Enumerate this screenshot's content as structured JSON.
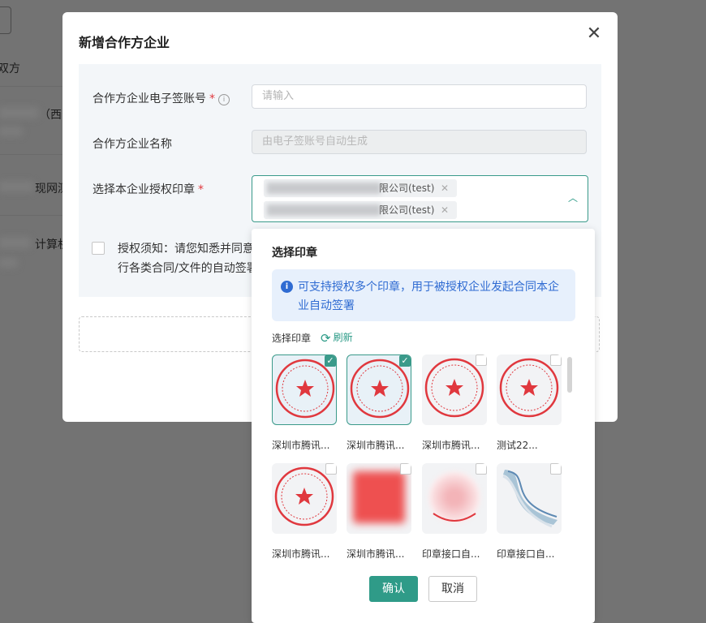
{
  "background": {
    "header_frag": "双方",
    "row1_frag": "（西安",
    "row2_frag": "现网测",
    "row3_frag": "计算机"
  },
  "modal": {
    "title": "新增合作方企业",
    "close_icon": "close-icon",
    "fields": {
      "account_label": "合作方企业电子签账号",
      "account_placeholder": "请输入",
      "name_label": "合作方企业名称",
      "name_placeholder": "由电子签账号自动生成",
      "seal_label": "选择本企业授权印章",
      "required_mark": "*"
    },
    "selected_seals": [
      {
        "label": "限公司(test)"
      },
      {
        "label": "限公司(test)"
      }
    ],
    "notice": {
      "line1": "授权须知：请您知悉并同意",
      "line2": "行各类合同/文件的自动签署"
    }
  },
  "dropdown": {
    "title": "选择印章",
    "alert": "可支持授权多个印章，用于被授权企业发起合同本企业自动签署",
    "section_label": "选择印章",
    "refresh_label": "刷新",
    "seals": [
      {
        "name": "深圳市腾讯...",
        "checked": true,
        "kind": "stamp"
      },
      {
        "name": "深圳市腾讯...",
        "checked": true,
        "kind": "stamp"
      },
      {
        "name": "深圳市腾讯...",
        "checked": false,
        "kind": "stamp"
      },
      {
        "name": "测试22...",
        "checked": false,
        "kind": "stamp"
      },
      {
        "name": "深圳市腾讯...",
        "checked": false,
        "kind": "stamp"
      },
      {
        "name": "深圳市腾讯...",
        "checked": false,
        "kind": "blurred-red"
      },
      {
        "name": "印章接口自...",
        "checked": false,
        "kind": "blurred-pink"
      },
      {
        "name": "印章接口自...",
        "checked": false,
        "kind": "ribbon"
      }
    ],
    "confirm_label": "确认",
    "cancel_label": "取消"
  },
  "colors": {
    "accent": "#2f9b88",
    "required": "#e0383e",
    "stamp_red": "#e0383e",
    "info_blue": "#2f6bd2"
  }
}
